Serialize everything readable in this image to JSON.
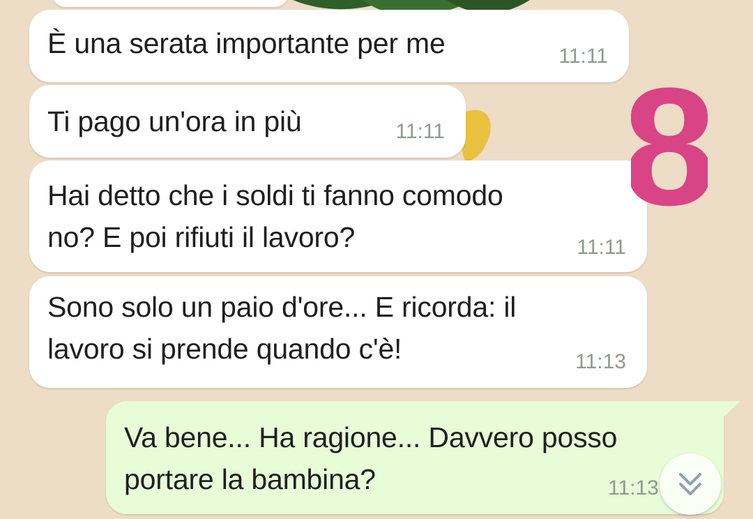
{
  "colors": {
    "background": "#eddcc6",
    "incoming_bubble": "#ffffff",
    "outgoing_bubble": "#e7fcd7",
    "timestamp": "#8e9a92",
    "badge": "#d94486"
  },
  "messages": [
    {
      "direction": "incoming",
      "text": "È una serata importante per me",
      "time": "11:11"
    },
    {
      "direction": "incoming",
      "text": "Ti pago un'ora in più",
      "time": "11:11"
    },
    {
      "direction": "incoming",
      "text": "Hai detto che i soldi ti fanno comodo\nno? E poi rifiuti il lavoro?",
      "time": "11:11"
    },
    {
      "direction": "incoming",
      "text": "Sono solo un paio d'ore... E ricorda: il\nlavoro si prende quando c'è!",
      "time": "11:13"
    },
    {
      "direction": "outgoing",
      "text": "Va bene... Ha ragione... Davvero posso\nportare la bambina?",
      "time": "11:13"
    }
  ],
  "overlay_number": "8",
  "scroll_button": {
    "icon": "double-chevron-down-icon"
  }
}
